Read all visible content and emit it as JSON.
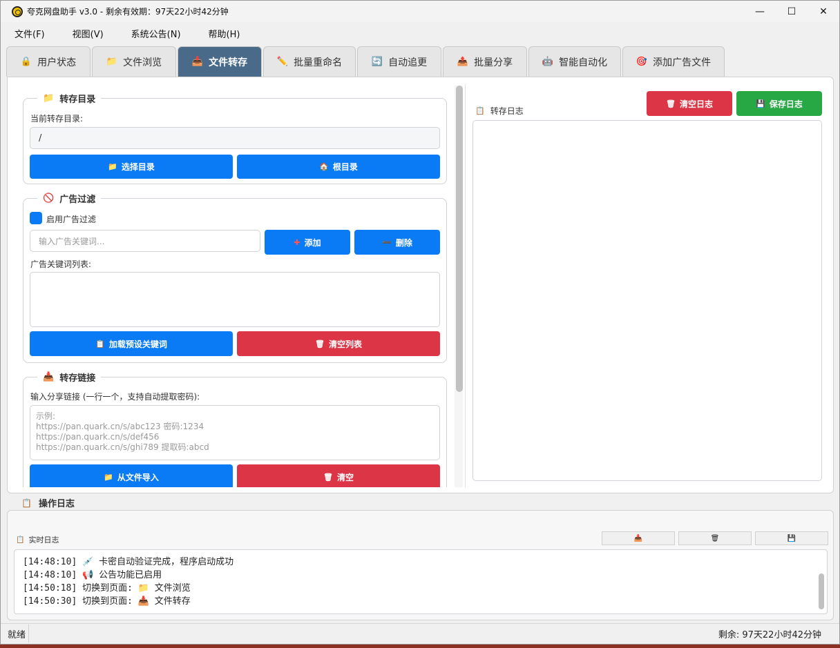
{
  "window": {
    "title": "夸克网盘助手 v3.0 - 剩余有效期：97天22小时42分钟"
  },
  "menu": [
    "文件(F)",
    "视图(V)",
    "系统公告(N)",
    "帮助(H)"
  ],
  "tabs": [
    {
      "label": "用户状态",
      "icon": "🔒",
      "active": false
    },
    {
      "label": "文件浏览",
      "icon": "📁",
      "active": false
    },
    {
      "label": "文件转存",
      "icon": "📥",
      "active": true
    },
    {
      "label": "批量重命名",
      "icon": "✏️",
      "active": false
    },
    {
      "label": "自动追更",
      "icon": "🔄",
      "active": false
    },
    {
      "label": "批量分享",
      "icon": "📤",
      "active": false
    },
    {
      "label": "智能自动化",
      "icon": "🤖",
      "active": false
    },
    {
      "label": "添加广告文件",
      "icon": "🎯",
      "active": false
    }
  ],
  "transfer_dir": {
    "title": "转存目录",
    "current_label": "当前转存目录:",
    "current_value": "/",
    "select_button": "选择目录",
    "root_button": "根目录"
  },
  "ad_filter": {
    "title": "广告过滤",
    "enable_label": "启用广告过滤",
    "enabled": true,
    "keyword_placeholder": "输入广告关键词...",
    "add_button": "添加",
    "delete_button": "删除",
    "list_label": "广告关键词列表:",
    "load_preset_button": "加载预设关键词",
    "clear_list_button": "清空列表"
  },
  "transfer_link": {
    "title": "转存链接",
    "input_label": "输入分享链接 (一行一个，支持自动提取密码):",
    "placeholder_lines": [
      "示例:",
      "https://pan.quark.cn/s/abc123 密码:1234",
      "https://pan.quark.cn/s/def456",
      "https://pan.quark.cn/s/ghi789 提取码:abcd"
    ],
    "import_button": "从文件导入",
    "clear_button": "清空"
  },
  "transfer_log": {
    "title": "转存日志",
    "clear_button": "清空日志",
    "save_button": "保存日志"
  },
  "operation_log": {
    "title": "操作日志",
    "realtime_title": "实时日志",
    "lines": [
      "[14:48:10] 💉 卡密自动验证完成，程序启动成功",
      "[14:48:10] 📢 公告功能已启用",
      "[14:50:18] 切换到页面: 📁 文件浏览",
      "[14:50:30] 切换到页面: 📥 文件转存"
    ]
  },
  "status": {
    "left": "就绪",
    "right": "剩余: 97天22小时42分钟"
  },
  "colors": {
    "primary": "#0a7bf5",
    "danger": "#dc3545",
    "success": "#28a745",
    "active_tab": "#4a6a8a"
  }
}
